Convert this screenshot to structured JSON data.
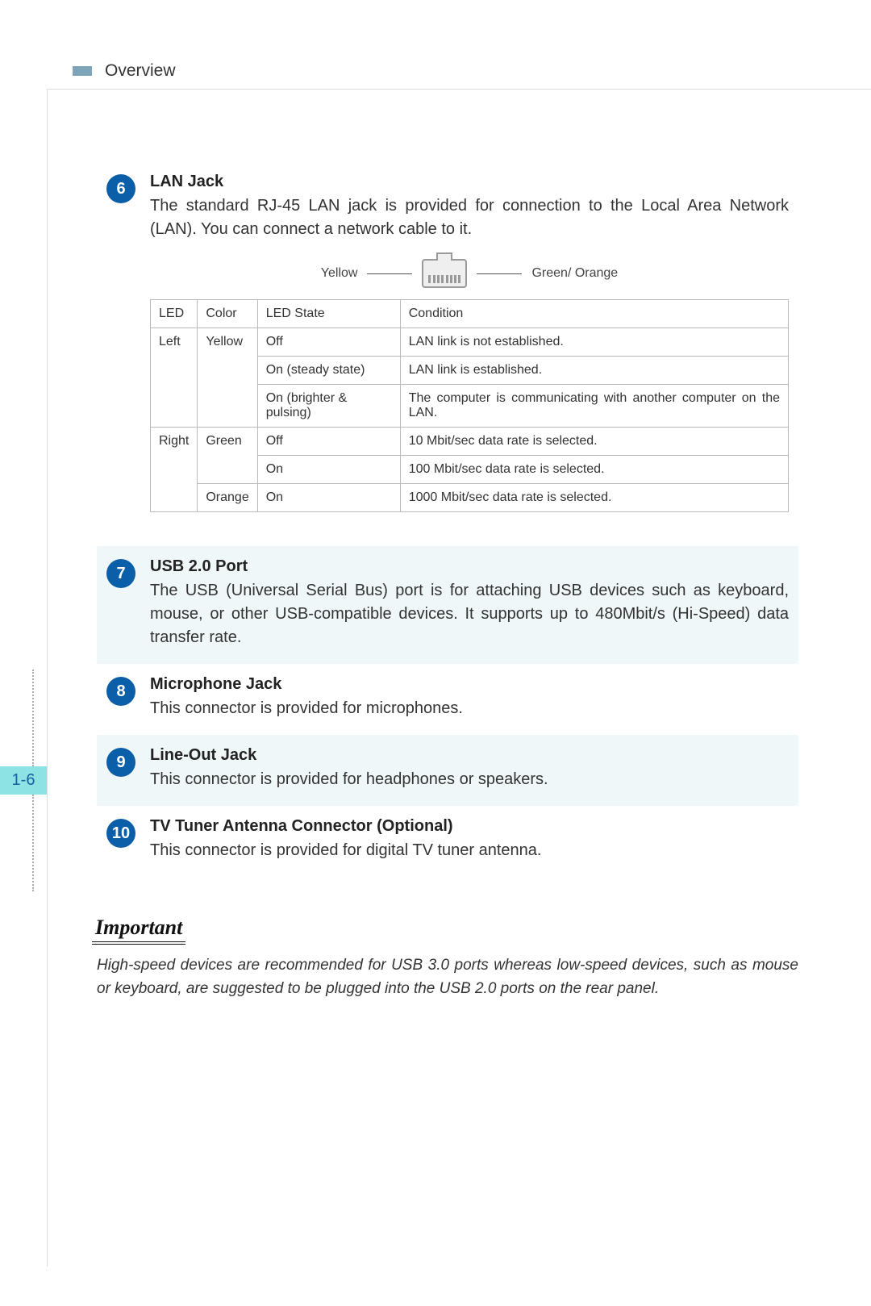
{
  "header": {
    "section": "Overview"
  },
  "page_number": "1-6",
  "lan_legend": {
    "left": "Yellow",
    "right": "Green/ Orange"
  },
  "lan_table": {
    "headers": [
      "LED",
      "Color",
      "LED State",
      "Condition"
    ],
    "rows": [
      {
        "led": "Left",
        "color": "Yellow",
        "state": "Off",
        "condition": "LAN link is not established."
      },
      {
        "led": "",
        "color": "",
        "state": "On (steady state)",
        "condition": "LAN link is established."
      },
      {
        "led": "",
        "color": "",
        "state": "On (brighter & pulsing)",
        "condition": "The computer is communicating with another computer on the LAN."
      },
      {
        "led": "Right",
        "color": "Green",
        "state": "Off",
        "condition": "10 Mbit/sec data rate is selected."
      },
      {
        "led": "",
        "color": "",
        "state": "On",
        "condition": "100 Mbit/sec data rate is selected."
      },
      {
        "led": "",
        "color": "Orange",
        "state": "On",
        "condition": "1000 Mbit/sec data rate is selected."
      }
    ]
  },
  "items": [
    {
      "num": "6",
      "title": "LAN Jack",
      "desc": "The standard RJ-45 LAN jack is provided for connection to the Local Area Network (LAN). You can connect a network cable to it.",
      "tinted": false,
      "has_table": true
    },
    {
      "num": "7",
      "title": "USB 2.0 Port",
      "desc": "The USB (Universal Serial Bus) port is for attaching USB devices such as keyboard, mouse, or other USB-compatible devices. It supports up to 480Mbit/s (Hi-Speed) data transfer rate.",
      "tinted": true
    },
    {
      "num": "8",
      "title": "Microphone Jack",
      "desc": "This connector is provided for microphones.",
      "tinted": false
    },
    {
      "num": "9",
      "title": "Line-Out Jack",
      "desc": "This connector is provided for headphones or speakers.",
      "tinted": true
    },
    {
      "num": "10",
      "title": "TV Tuner Antenna Connector (Optional)",
      "desc": "This connector is provided for digital TV tuner antenna.",
      "tinted": false
    }
  ],
  "important": {
    "label": "Important",
    "text": "High-speed devices are recommended for USB 3.0 ports whereas low-speed devices, such as mouse or keyboard, are suggested to be plugged into the USB 2.0 ports on the rear panel."
  }
}
